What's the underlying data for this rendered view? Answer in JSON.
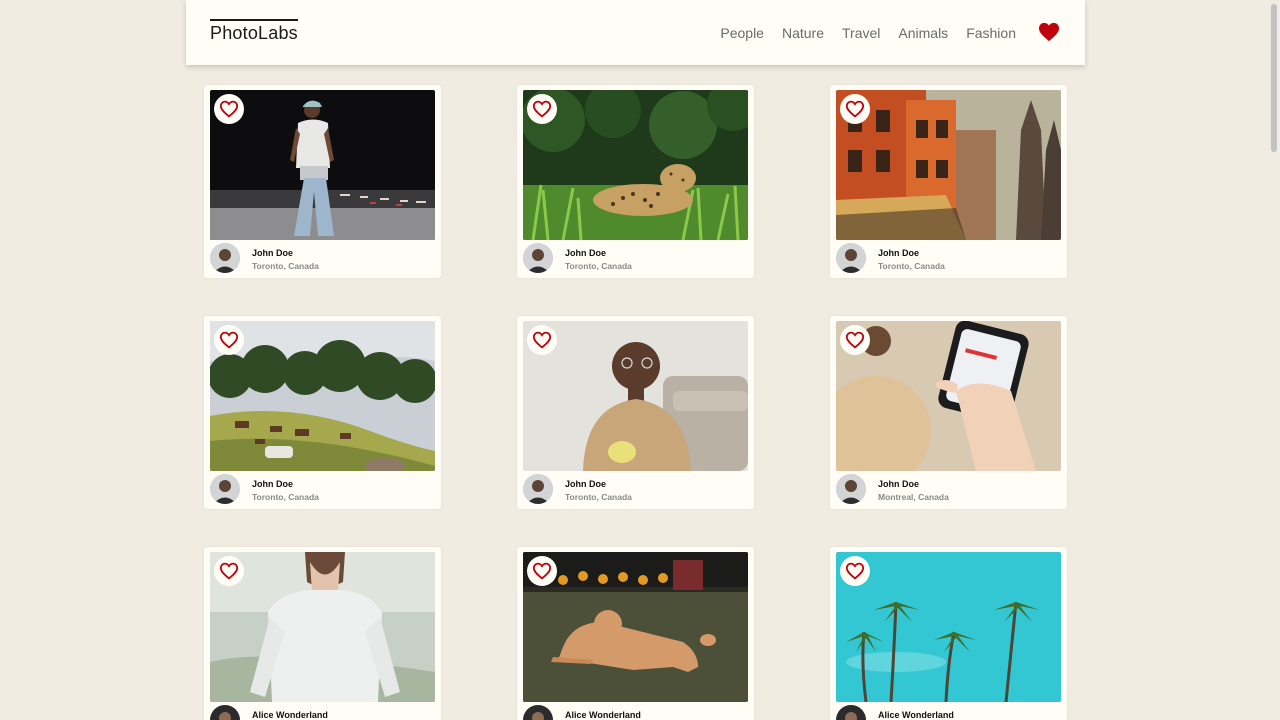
{
  "navbar": {
    "logo": "PhotoLabs",
    "topics": [
      "People",
      "Nature",
      "Travel",
      "Animals",
      "Fashion"
    ],
    "fav_color": "#c0000c"
  },
  "colors": {
    "background": "#f0ece2",
    "card": "#fffdf6",
    "heart_outline": "#c0000c"
  },
  "photos": [
    {
      "scene": "man-night-street",
      "user": {
        "name": "John Doe",
        "location": "Toronto, Canada"
      }
    },
    {
      "scene": "jaguar-in-grass",
      "user": {
        "name": "John Doe",
        "location": "Toronto, Canada"
      }
    },
    {
      "scene": "orange-buildings-canal",
      "user": {
        "name": "John Doe",
        "location": "Toronto, Canada"
      }
    },
    {
      "scene": "horses-on-hillside",
      "user": {
        "name": "John Doe",
        "location": "Toronto, Canada"
      }
    },
    {
      "scene": "woman-with-mug",
      "user": {
        "name": "John Doe",
        "location": "Toronto, Canada"
      }
    },
    {
      "scene": "hand-holding-phone",
      "user": {
        "name": "John Doe",
        "location": "Montreal, Canada"
      }
    },
    {
      "scene": "woman-white-sweater",
      "user": {
        "name": "Alice Wonderland",
        "location": ""
      }
    },
    {
      "scene": "dog-on-grass",
      "user": {
        "name": "Alice Wonderland",
        "location": ""
      }
    },
    {
      "scene": "palm-trees-sky",
      "user": {
        "name": "Alice Wonderland",
        "location": ""
      }
    }
  ]
}
